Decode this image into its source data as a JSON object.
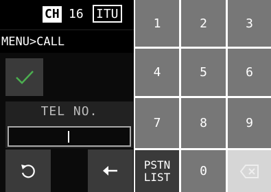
{
  "status": {
    "channel_label": "CH",
    "channel_number": "16",
    "channel_system": "ITU"
  },
  "breadcrumb": "MENU>CALL",
  "tel": {
    "label": "TEL NO.",
    "value": ""
  },
  "keypad": {
    "k1": "1",
    "k2": "2",
    "k3": "3",
    "k4": "4",
    "k5": "5",
    "k6": "6",
    "k7": "7",
    "k8": "8",
    "k9": "9",
    "pstn_line1": "PSTN",
    "pstn_line2": "LIST",
    "k0": "0"
  },
  "icons": {
    "confirm": "checkmark-icon",
    "back": "undo-icon",
    "cursor_left": "left-arrow-icon",
    "backspace": "backspace-icon"
  },
  "colors": {
    "confirm_check": "#4caf50",
    "key_bg": "#777777",
    "panel_bg": "#3a3a3a",
    "disabled_key_bg": "#d6d6d6"
  }
}
